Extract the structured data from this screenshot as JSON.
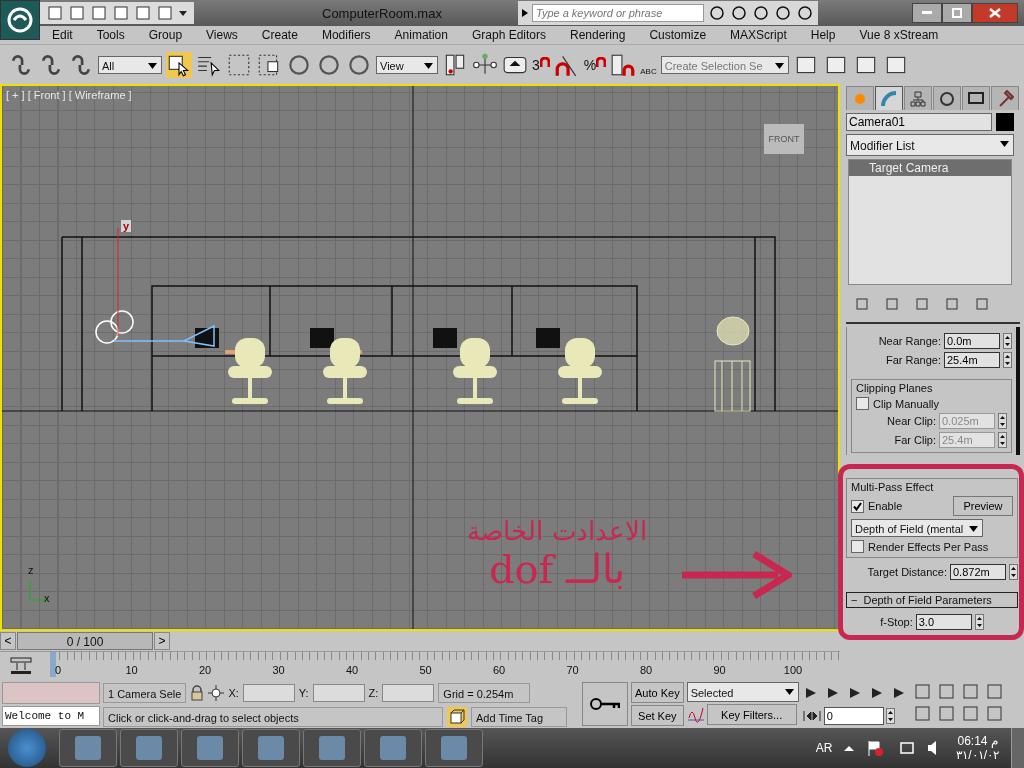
{
  "title_bar": {
    "title": "ComputerRoom.max",
    "search_placeholder": "Type a keyword or phrase"
  },
  "menu": [
    "Edit",
    "Tools",
    "Group",
    "Views",
    "Create",
    "Modifiers",
    "Animation",
    "Graph Editors",
    "Rendering",
    "Customize",
    "MAXScript",
    "Help",
    "Vue 8 xStream"
  ],
  "toolbar": {
    "selection_filter": "All",
    "reference_coordinate": "View",
    "named_selection": "Create Selection Se",
    "snap_label": "3",
    "percent_snap_label": "%",
    "edit_named_label": "ABC"
  },
  "viewport": {
    "label": "[ + ] [ Front ] [ Wireframe ]",
    "viewcube_face": "FRONT",
    "camera_axis_label": "y",
    "axis_labels": [
      "z",
      "x"
    ]
  },
  "annotation": {
    "lines": [
      "الاعدادت الخاصة",
      "بالــ dof"
    ]
  },
  "command_panel": {
    "tabs": [
      {
        "kind": "create",
        "selected": false
      },
      {
        "kind": "modify",
        "selected": true
      },
      {
        "kind": "hierarchy",
        "selected": false
      },
      {
        "kind": "motion",
        "selected": false
      },
      {
        "kind": "display",
        "selected": false
      },
      {
        "kind": "utilities",
        "selected": false
      }
    ],
    "object_name": "Camera01",
    "modifier_list": "Modifier List",
    "stack": [
      {
        "label": "Target Camera",
        "selected": true
      }
    ],
    "near_range": {
      "label": "Near Range:",
      "value": "0.0m"
    },
    "far_range": {
      "label": "Far Range:",
      "value": "25.4m"
    },
    "clipping": {
      "title": "Clipping Planes",
      "clip_manually": {
        "label": "Clip Manually",
        "checked": false
      },
      "near_clip": {
        "label": "Near Clip:",
        "value": "0.025m",
        "disabled": true
      },
      "far_clip": {
        "label": "Far Clip:",
        "value": "25.4m",
        "disabled": true
      }
    },
    "multi_pass": {
      "title": "Multi-Pass Effect",
      "enable": {
        "label": "Enable",
        "checked": true
      },
      "preview": "Preview",
      "effect": "Depth of Field (mental",
      "render_effects": {
        "label": "Render Effects Per Pass",
        "checked": false
      }
    },
    "target_distance": {
      "label": "Target Distance:",
      "value": "0.872m"
    },
    "dof_rollout": {
      "sign": "−",
      "title": "Depth of Field Parameters",
      "f_stop": {
        "label": "f-Stop:",
        "value": "3.0"
      }
    }
  },
  "timeline": {
    "prev": "<",
    "frame_counter": "0 / 100",
    "next": ">",
    "ticks": [
      "0",
      "10",
      "20",
      "30",
      "40",
      "50",
      "60",
      "70",
      "80",
      "90",
      "100"
    ]
  },
  "status": {
    "listener": "Welcome to M",
    "selection": "1 Camera Sele",
    "x_label": "X:",
    "y_label": "Y:",
    "z_label": "Z:",
    "grid": "Grid = 0.254m",
    "prompt": "Click or click-and-drag to select objects",
    "add_time_tag": "Add Time Tag",
    "auto_key": "Auto Key",
    "set_key": "Set Key",
    "key_mode": "Selected",
    "key_filters": "Key Filters...",
    "frame": "0"
  },
  "taskbar": {
    "language": "AR",
    "time": "06:14 م",
    "date": "٣١/٠١/٠٢"
  }
}
